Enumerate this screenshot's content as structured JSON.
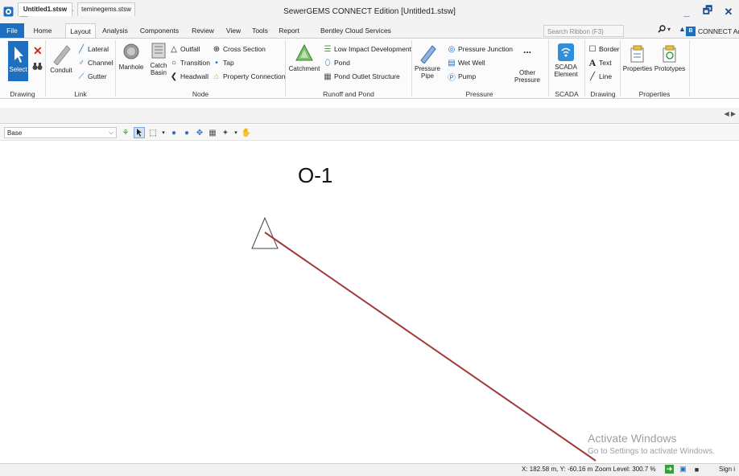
{
  "window": {
    "title": "SewerGEMS CONNECT Edition [Untitled1.stsw]",
    "controls": {
      "minimize": "_",
      "restore": "🗗",
      "close": "✕"
    }
  },
  "quick_access": [
    "app-icon",
    "new-icon",
    "open-icon",
    "save-icon",
    "undo-icon",
    "redo-icon",
    "print-preview-icon",
    "customize-icon"
  ],
  "ribbon_tabs": [
    {
      "label": "File"
    },
    {
      "label": "Home"
    },
    {
      "label": "Layout"
    },
    {
      "label": "Analysis"
    },
    {
      "label": "Components"
    },
    {
      "label": "Review"
    },
    {
      "label": "View"
    },
    {
      "label": "Tools"
    },
    {
      "label": "Report"
    },
    {
      "label": "Bentley Cloud Services"
    }
  ],
  "active_tab": "Layout",
  "search": {
    "placeholder": "Search Ribbon (F3)"
  },
  "advisor": {
    "label": "CONNECT Advisor"
  },
  "ribbon": {
    "drawing": {
      "group_label": "Drawing",
      "select": "Select"
    },
    "link": {
      "group_label": "Link",
      "conduit": "Conduit",
      "lateral": "Lateral",
      "channel": "Channel",
      "gutter": "Gutter"
    },
    "node": {
      "group_label": "Node",
      "manhole": "Manhole",
      "catch_basin": "Catch Basin",
      "outfall": "Outfall",
      "transition": "Transition",
      "headwall": "Headwall",
      "cross_section": "Cross Section",
      "tap": "Tap",
      "property_connection": "Property Connection"
    },
    "runoff": {
      "group_label": "Runoff and Pond",
      "catchment": "Catchment",
      "lid": "Low Impact Development",
      "pond": "Pond",
      "pond_outlet": "Pond Outlet Structure"
    },
    "pressure": {
      "group_label": "Pressure",
      "pressure_pipe": "Pressure Pipe",
      "pressure_junction": "Pressure Junction",
      "wet_well": "Wet Well",
      "pump": "Pump",
      "more": "...",
      "other_pressure": "Other Pressure"
    },
    "scada": {
      "group_label": "SCADA",
      "scada_element": "SCADA Element"
    },
    "drawing2": {
      "group_label": "Drawing",
      "border": "Border",
      "text": "Text",
      "line": "Line"
    },
    "properties": {
      "group_label": "Properties",
      "properties": "Properties",
      "prototypes": "Prototypes"
    }
  },
  "document_tabs": [
    {
      "label": "Untitled1.stsw",
      "active": true
    },
    {
      "label": "teminegems.stsw",
      "active": false
    }
  ],
  "drawing_toolbar": {
    "base_select": "Base"
  },
  "canvas": {
    "outfall_label": "O-1",
    "conduit_color": "#a33a3a",
    "watermark_title": "Activate Windows",
    "watermark_sub": "Go to Settings to activate Windows."
  },
  "status": {
    "coords": "X: 182.58 m, Y: -60.16 m",
    "zoom": "Zoom Level: 300.7 %",
    "sign": "Sign i"
  },
  "colors": {
    "accent": "#1f6fc1",
    "conduit": "#a33a3a"
  }
}
